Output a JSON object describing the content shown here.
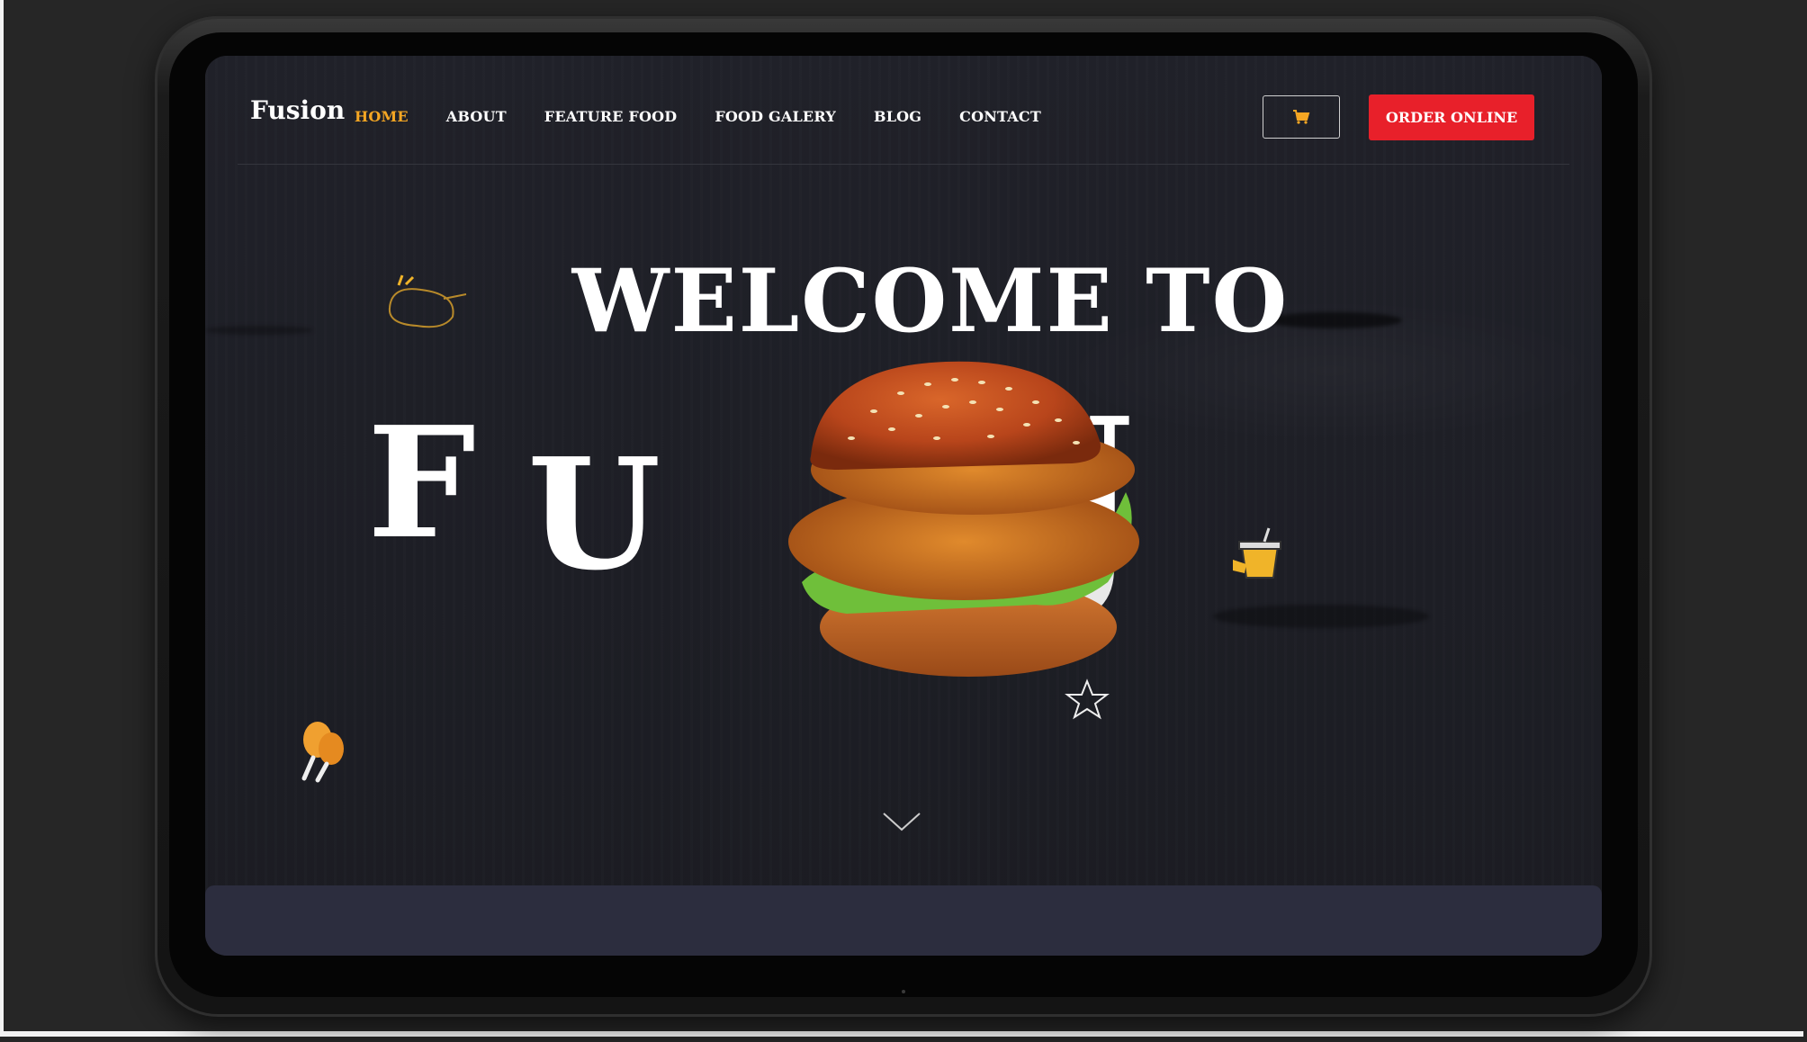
{
  "app": {
    "brand": "Fusion"
  },
  "nav": {
    "items": [
      {
        "label": "HOME",
        "active": true
      },
      {
        "label": "ABOUT",
        "active": false
      },
      {
        "label": "FEATURE FOOD",
        "active": false
      },
      {
        "label": "FOOD GALERY",
        "active": false
      },
      {
        "label": "BLOG",
        "active": false
      },
      {
        "label": "CONTACT",
        "active": false
      }
    ],
    "cart_icon": "cart-icon",
    "order_label": "ORDER ONLINE"
  },
  "hero": {
    "headline": "WELCOME TO",
    "letters": {
      "f": "F",
      "u": "U",
      "n": "N"
    },
    "scroll_icon": "chevron-down-icon"
  },
  "colors": {
    "accent": "#f5a623",
    "cta": "#e8202a",
    "background": "#1e1f26",
    "panel": "#2c2d3e"
  }
}
